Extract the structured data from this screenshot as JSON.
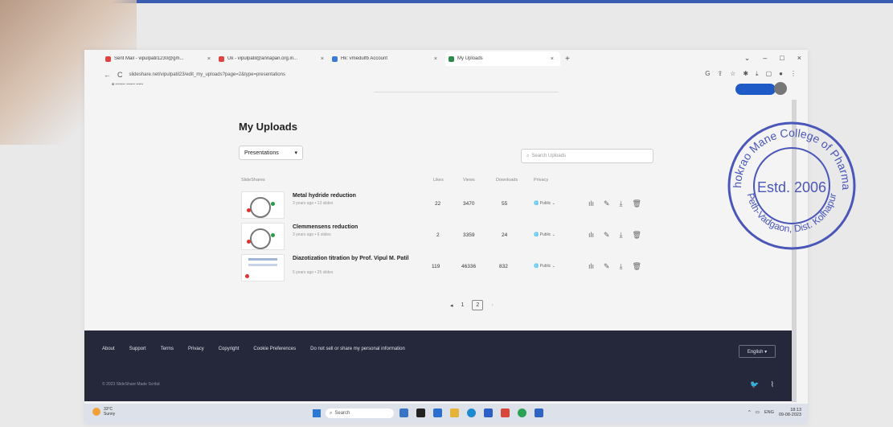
{
  "browser": {
    "tabs": [
      {
        "label": "Sent Mail - vipulpatil1230@gm...",
        "active": false
      },
      {
        "label": "Uk - vipulpatil@annapan.org.in...",
        "active": false
      },
      {
        "label": "Hk: vmedulfb Account",
        "active": false
      },
      {
        "label": "My Uploads",
        "active": true
      }
    ],
    "url": "slideshare.net/vipulpatil23/edit_my_uploads?page=2&type=presentations"
  },
  "main": {
    "title": "My Uploads",
    "filter": {
      "selected": "Presentations"
    },
    "search": {
      "placeholder": "Search Uploads"
    },
    "columns": {
      "name": "SlideShares",
      "likes": "Likes",
      "views": "Views",
      "downloads": "Downloads",
      "privacy": "Privacy"
    },
    "rows": [
      {
        "title": "Metal hydride reduction",
        "meta": "3 years ago • 13 slides",
        "likes": "22",
        "views": "3470",
        "downloads": "55",
        "privacy": "Public"
      },
      {
        "title": "Clemmensens reduction",
        "meta": "3 years ago • 6 slides",
        "likes": "2",
        "views": "3359",
        "downloads": "24",
        "privacy": "Public"
      },
      {
        "title": "Diazotization titration by Prof. Vipul M. Patil",
        "meta": "5 years ago • 25 slides",
        "likes": "119",
        "views": "46336",
        "downloads": "832",
        "privacy": "Public"
      }
    ],
    "pagination": {
      "prev": "◂",
      "pages": [
        "1",
        "2"
      ],
      "current": "2",
      "next": "›"
    }
  },
  "footer": {
    "links": [
      "About",
      "Support",
      "Terms",
      "Privacy",
      "Copyright",
      "Cookie Preferences",
      "Do not sell or share my personal information"
    ],
    "language": "English ▾",
    "copyright": "© 2023 SlideShare Made Scribd"
  },
  "taskbar": {
    "weather_temp": "33°C",
    "weather_desc": "Sunny",
    "search": "Search",
    "lang": "ENG",
    "time": "18:13",
    "date": "09-08-2023"
  },
  "stamp": {
    "top_text": "Ashokrao Mane College of Pharmacy",
    "center_text": "Estd. 2006",
    "bottom_text": "Peth-Vadgaon, Dist. Kolhapur",
    "color": "#4a57b8"
  }
}
